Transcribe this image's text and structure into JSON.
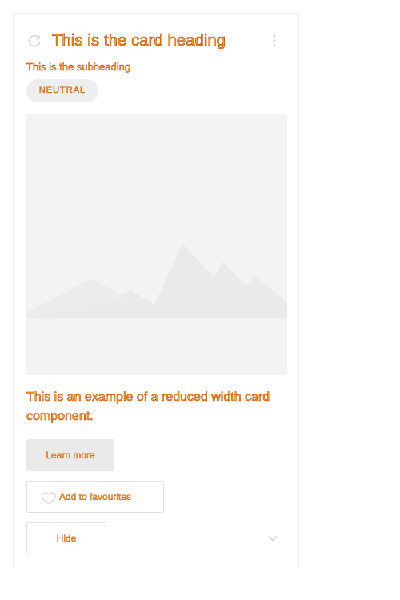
{
  "card": {
    "title": "This is the card heading",
    "subheading": "This is the subheading",
    "chip": "NEUTRAL",
    "body": "This is an example of a reduced width card component.",
    "primary_button": "Learn more",
    "favourite_button": "Add to favourites",
    "hide_button": "Hide"
  },
  "icons": {
    "refresh": "refresh-icon",
    "more": "more-vertical-icon",
    "heart": "heart-outline-icon",
    "chevron": "chevron-down-icon",
    "image": "image-placeholder-icon"
  },
  "colors": {
    "text_fill": "#f5c000",
    "text_stroke": "#cc1f00",
    "placeholder_bg": "#f3f3f3",
    "button_bg": "#eaeaea"
  }
}
